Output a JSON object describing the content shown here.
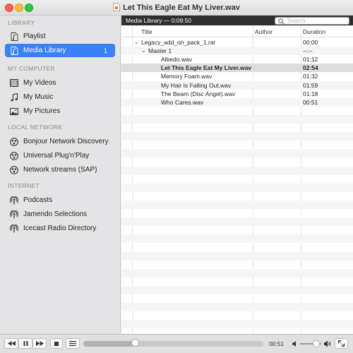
{
  "window": {
    "title": "Let This Eagle Eat My Liver.wav"
  },
  "sidebar": {
    "sections": [
      {
        "header": "LIBRARY",
        "items": [
          {
            "label": "Playlist",
            "icon": "music-note-doc-icon"
          },
          {
            "label": "Media Library",
            "icon": "music-note-doc-icon",
            "badge": "1",
            "active": true
          }
        ]
      },
      {
        "header": "MY COMPUTER",
        "items": [
          {
            "label": "My Videos",
            "icon": "film-icon"
          },
          {
            "label": "My Music",
            "icon": "music-note-icon"
          },
          {
            "label": "My Pictures",
            "icon": "picture-icon"
          }
        ]
      },
      {
        "header": "LOCAL NETWORK",
        "items": [
          {
            "label": "Bonjour Network Discovery",
            "icon": "network-icon"
          },
          {
            "label": "Universal Plug'n'Play",
            "icon": "network-icon"
          },
          {
            "label": "Network streams (SAP)",
            "icon": "network-icon"
          }
        ]
      },
      {
        "header": "INTERNET",
        "items": [
          {
            "label": "Podcasts",
            "icon": "podcast-icon"
          },
          {
            "label": "Jamendo Selections",
            "icon": "podcast-icon"
          },
          {
            "label": "Icecast Radio Directory",
            "icon": "podcast-icon"
          }
        ]
      }
    ]
  },
  "main": {
    "header_title": "Media Library — 0:09:50",
    "search_placeholder": "Search",
    "columns": {
      "title": "Title",
      "author": "Author",
      "duration": "Duration"
    },
    "rows": [
      {
        "title": "Legacy_add_on_pack_1.rar",
        "duration": "00:00",
        "level": 0,
        "expanded": true
      },
      {
        "title": "Master 1",
        "duration": "--:--",
        "level": 1,
        "expanded": true
      },
      {
        "title": "Albedo.wav",
        "duration": "01:12",
        "level": 2
      },
      {
        "title": "Let This Eagle Eat My Liver.wav",
        "duration": "02:54",
        "level": 2,
        "playing": true
      },
      {
        "title": "Memory Foam.wav",
        "duration": "01:32",
        "level": 2
      },
      {
        "title": "My Hair Is Falling Out.wav",
        "duration": "01:59",
        "level": 2
      },
      {
        "title": "The Beam (Disc Angel).wav",
        "duration": "01:18",
        "level": 2
      },
      {
        "title": "Who Cares.wav",
        "duration": "00:51",
        "level": 2
      }
    ]
  },
  "controls": {
    "elapsed": "00:51",
    "progress": 0.29,
    "volume": 0.75
  }
}
